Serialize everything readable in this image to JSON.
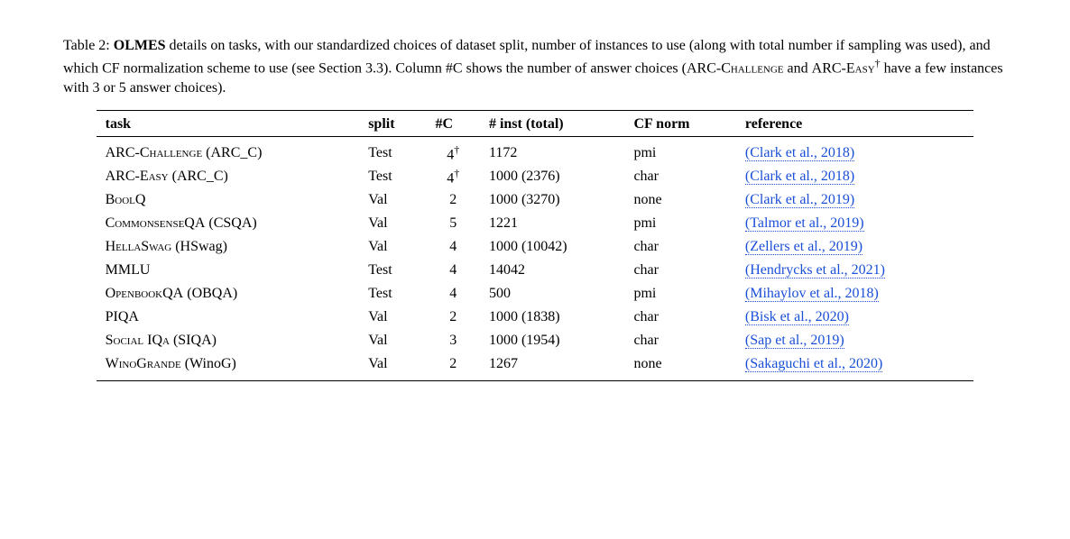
{
  "caption": {
    "prefix": "Table 2: ",
    "bold": "OLMES",
    "rest1": " details on tasks, with our standardized choices of dataset split, number of instances to use (along with total number if sampling was used), and which CF normalization scheme to use (see Section 3.3). Column #C shows the number of answer choices (",
    "sc1": "ARC-Challenge",
    "rest2": " and ",
    "sc2": "ARC-Easy",
    "dagger": "†",
    "rest3": " have a few instances with 3 or 5 answer choices)."
  },
  "headers": {
    "task": "task",
    "split": "split",
    "c": "#C",
    "inst": "# inst (total)",
    "cfnorm": "CF norm",
    "reference": "reference"
  },
  "rows": [
    {
      "task_sc": "ARC-Challenge",
      "task_short": " (ARC_C)",
      "split": "Test",
      "c": "4",
      "c_dagger": true,
      "inst": "1172",
      "total": "",
      "cfnorm": "pmi",
      "ref": "(Clark et al., 2018)"
    },
    {
      "task_sc": "ARC-Easy",
      "task_short": " (ARC_C)",
      "split": "Test",
      "c": "4",
      "c_dagger": true,
      "inst": "1000",
      "total": " (2376)",
      "cfnorm": "char",
      "ref": "(Clark et al., 2018)"
    },
    {
      "task_sc": "BoolQ",
      "task_short": "",
      "split": "Val",
      "c": "2",
      "c_dagger": false,
      "inst": "1000",
      "total": " (3270)",
      "cfnorm": "none",
      "ref": "(Clark et al., 2019)"
    },
    {
      "task_sc": "CommonsenseQA",
      "task_short": " (CSQA)",
      "split": "Val",
      "c": "5",
      "c_dagger": false,
      "inst": "1221",
      "total": "",
      "cfnorm": "pmi",
      "ref": "(Talmor et al., 2019)"
    },
    {
      "task_sc": "HellaSwag",
      "task_short": " (HSwag)",
      "split": "Val",
      "c": "4",
      "c_dagger": false,
      "inst": "1000",
      "total": " (10042)",
      "cfnorm": "char",
      "ref": "(Zellers et al., 2019)"
    },
    {
      "task_sc": "MMLU",
      "task_short": "",
      "split": "Test",
      "c": "4",
      "c_dagger": false,
      "inst": "14042",
      "total": "",
      "cfnorm": "char",
      "ref": "(Hendrycks et al., 2021)"
    },
    {
      "task_sc": "OpenbookQA",
      "task_short": " (OBQA)",
      "split": "Test",
      "c": "4",
      "c_dagger": false,
      "inst": "500",
      "total": "",
      "cfnorm": "pmi",
      "ref": "(Mihaylov et al., 2018)"
    },
    {
      "task_sc": "PIQA",
      "task_short": "",
      "split": "Val",
      "c": "2",
      "c_dagger": false,
      "inst": "1000",
      "total": " (1838)",
      "cfnorm": "char",
      "ref": "(Bisk et al., 2020)"
    },
    {
      "task_sc": "Social IQa",
      "task_short": " (SIQA)",
      "split": "Val",
      "c": "3",
      "c_dagger": false,
      "inst": "1000",
      "total": " (1954)",
      "cfnorm": "char",
      "ref": "(Sap et al., 2019)"
    },
    {
      "task_sc": "WinoGrande",
      "task_short": " (WinoG)",
      "split": "Val",
      "c": "2",
      "c_dagger": false,
      "inst": "1267",
      "total": "",
      "cfnorm": "none",
      "ref": "(Sakaguchi et al., 2020)"
    }
  ],
  "chart_data": {
    "type": "table",
    "columns": [
      "task",
      "split",
      "#C",
      "# inst (total)",
      "CF norm",
      "reference"
    ],
    "rows": [
      [
        "ARC-CHALLENGE (ARC_C)",
        "Test",
        "4†",
        "1172",
        "pmi",
        "(Clark et al., 2018)"
      ],
      [
        "ARC-EASY (ARC_C)",
        "Test",
        "4†",
        "1000 (2376)",
        "char",
        "(Clark et al., 2018)"
      ],
      [
        "BOOLQ",
        "Val",
        "2",
        "1000 (3270)",
        "none",
        "(Clark et al., 2019)"
      ],
      [
        "COMMONSENSEQA (CSQA)",
        "Val",
        "5",
        "1221",
        "pmi",
        "(Talmor et al., 2019)"
      ],
      [
        "HELLASWAG (HSwag)",
        "Val",
        "4",
        "1000 (10042)",
        "char",
        "(Zellers et al., 2019)"
      ],
      [
        "MMLU",
        "Test",
        "4",
        "14042",
        "char",
        "(Hendrycks et al., 2021)"
      ],
      [
        "OPENBOOKQA (OBQA)",
        "Test",
        "4",
        "500",
        "pmi",
        "(Mihaylov et al., 2018)"
      ],
      [
        "PIQA",
        "Val",
        "2",
        "1000 (1838)",
        "char",
        "(Bisk et al., 2020)"
      ],
      [
        "SOCIAL IQA (SIQA)",
        "Val",
        "3",
        "1000 (1954)",
        "char",
        "(Sap et al., 2019)"
      ],
      [
        "WINOGRANDE (WinoG)",
        "Val",
        "2",
        "1267",
        "none",
        "(Sakaguchi et al., 2020)"
      ]
    ]
  }
}
